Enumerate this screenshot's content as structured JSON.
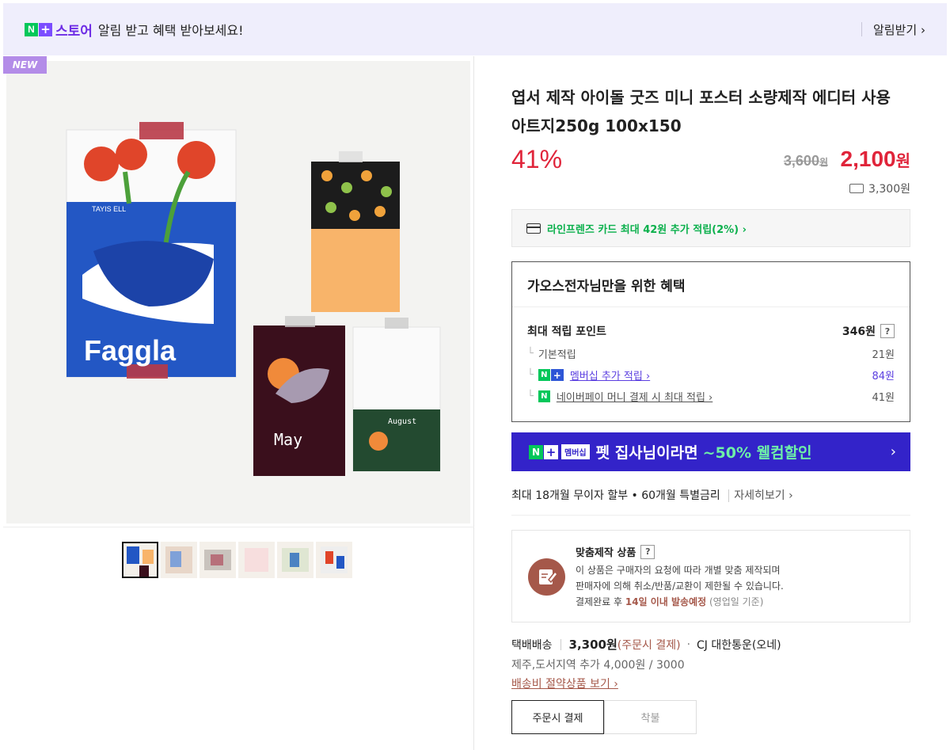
{
  "topbar": {
    "logo_n": "N",
    "logo_plus": "+",
    "store_word": "스토어",
    "message": "알림 받고 혜택 받아보세요!",
    "cta": "알림받기 ›"
  },
  "gallery": {
    "new_badge": "NEW",
    "thumbnail_count": 6,
    "selected_thumbnail": 1
  },
  "product": {
    "title": "엽서 제작 아이돌 굿즈 미니 포스터 소량제작 에디터 사용 아트지250g 100x150",
    "discount": "41%",
    "original_price": "3,600",
    "original_unit": "원",
    "sale_price": "2,100",
    "sale_unit": "원",
    "shipping_fee": "3,300원"
  },
  "card_promo": "라인프렌즈 카드 최대 42원 추가 적립(2%) ›",
  "benefit": {
    "heading": "가오스전자님만을 위한 혜택",
    "max_points_label": "최대 적립 포인트",
    "max_points_value": "346원",
    "help": "?",
    "basic_label": "기본적립",
    "basic_value": "21원",
    "membership_label": "멤버십 추가 적립 ›",
    "membership_value": "84원",
    "naverpay_label": "네이버페이 머니 결제 시 최대 적립 ›",
    "naverpay_value": "41원"
  },
  "membership_banner": {
    "badge": "멤버십",
    "text": "펫 집사님이라면",
    "highlight": "~50% 웰컴할인",
    "arrow": "›"
  },
  "installment": {
    "text": "최대 18개월 무이자 할부 • 60개월 특별금리",
    "link": "자세히보기 ›"
  },
  "custom_notice": {
    "title": "맞춤제작 상품",
    "help": "?",
    "line1": "이 상품은 구매자의 요청에 따라 개별 맞춤 제작되며",
    "line2": "판매자에 의해 취소/반품/교환이 제한될 수 있습니다.",
    "line3_prefix": "결제완료 후 ",
    "line3_highlight": "14일 이내 발송예정",
    "line3_suffix": " (영업일 기준)"
  },
  "shipping": {
    "method": "택배배송",
    "fee": "3,300원",
    "fee_note": "(주문시 결제)",
    "carrier": "CJ 대한통운(오네)",
    "extra": "제주,도서지역 추가 4,000원 / 3000",
    "link": "배송비 절약상품 보기 ›",
    "pay_on_order": "주문시 결제",
    "pay_on_delivery": "착불"
  },
  "colors": {
    "accent_red": "#e0243a",
    "naver_green": "#03c75a",
    "membership_purple": "#3323c9",
    "custom_brown": "#a5584a"
  }
}
